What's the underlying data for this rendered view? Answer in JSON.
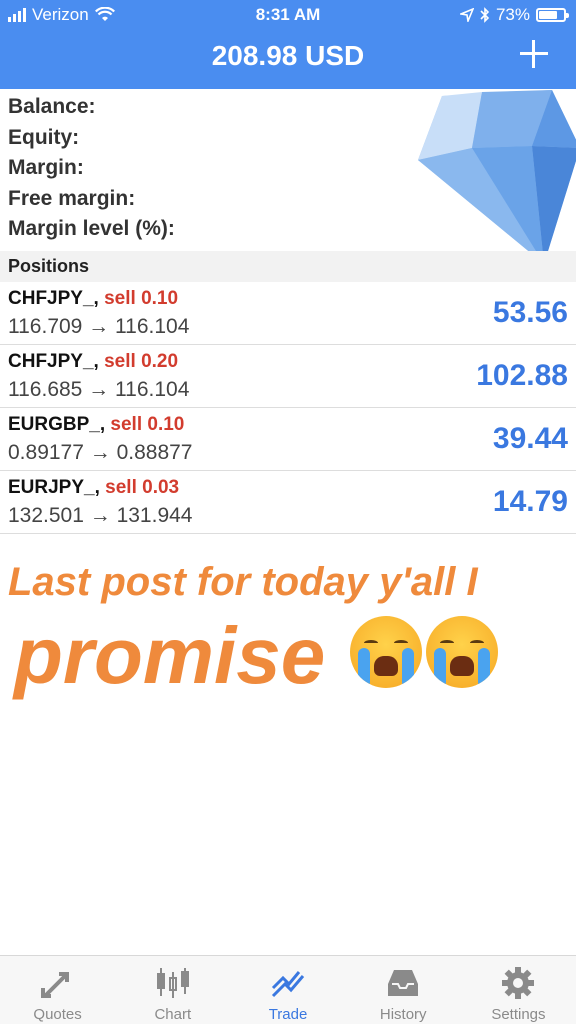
{
  "status_bar": {
    "carrier": "Verizon",
    "time": "8:31 AM",
    "battery": "73%"
  },
  "header": {
    "title": "208.98 USD"
  },
  "summary": [
    {
      "label": "Balance:",
      "value": ""
    },
    {
      "label": "Equity:",
      "value": ""
    },
    {
      "label": "Margin:",
      "value": ""
    },
    {
      "label": "Free margin:",
      "value": ""
    },
    {
      "label": "Margin level (%):",
      "value": ""
    }
  ],
  "positions_header": "Positions",
  "positions": [
    {
      "symbol": "CHFJPY_,",
      "side": "sell 0.10",
      "prices": "116.709 → 116.104",
      "profit": "53.56"
    },
    {
      "symbol": "CHFJPY_,",
      "side": "sell 0.20",
      "prices": "116.685 → 116.104",
      "profit": "102.88"
    },
    {
      "symbol": "EURGBP_,",
      "side": "sell 0.10",
      "prices": "0.89177 → 0.88877",
      "profit": "39.44"
    },
    {
      "symbol": "EURJPY_,",
      "side": "sell 0.03",
      "prices": "132.501 → 131.944",
      "profit": "14.79"
    }
  ],
  "overlay": {
    "line1": "Last post for today y'all I",
    "line2": "promise"
  },
  "tabs": [
    {
      "label": "Quotes",
      "icon": "quotes-arrows-icon"
    },
    {
      "label": "Chart",
      "icon": "candlestick-icon"
    },
    {
      "label": "Trade",
      "icon": "trade-chart-icon",
      "active": true
    },
    {
      "label": "History",
      "icon": "inbox-icon"
    },
    {
      "label": "Settings",
      "icon": "gear-icon"
    }
  ],
  "colors": {
    "accent": "#4a8df0",
    "sell": "#d23c2e",
    "profit": "#3a78e0",
    "overlay": "#ef8a3c"
  }
}
